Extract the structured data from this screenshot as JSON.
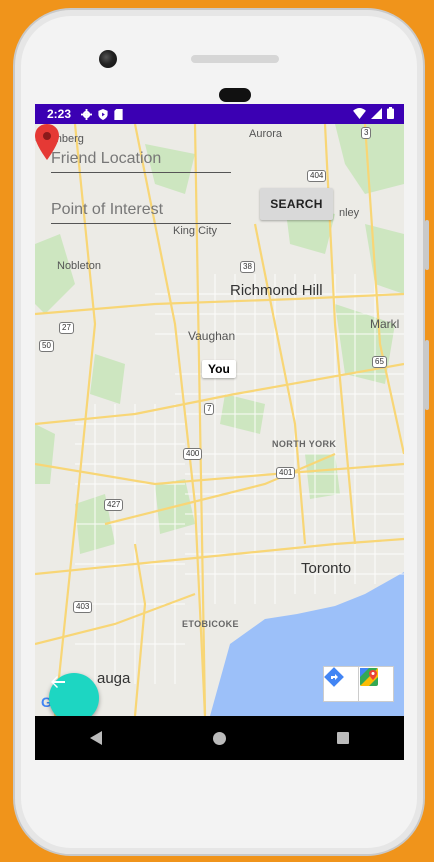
{
  "status": {
    "time": "2:23"
  },
  "form": {
    "friend_placeholder": "Friend Location",
    "poi_placeholder": "Point of Interest",
    "search_label": "SEARCH"
  },
  "map": {
    "places": {
      "aurora": "Aurora",
      "schomberg": "chomberg",
      "nobleton": "Nobleton",
      "king_city": "King City",
      "stouffville_partial": "nley",
      "richmond_hill": "Richmond Hill",
      "vaughan": "Vaughan",
      "markham_partial": "Markl",
      "north_york": "NORTH YORK",
      "toronto": "Toronto",
      "etobicoke": "ETOBICOKE",
      "mississauga_partial": "auga"
    },
    "highways": {
      "h3": "3",
      "h404": "404",
      "h404b": "404",
      "h38": "38",
      "h27": "27",
      "h50": "50",
      "h65": "65",
      "h400": "400",
      "h401": "401",
      "h427": "427",
      "h403": "403",
      "h7": "7"
    },
    "marker_label": "You",
    "attribution": "Google"
  },
  "icons": {
    "back_fab": "arrow-left-icon",
    "directions": "directions-icon",
    "maps": "google-maps-icon"
  },
  "colors": {
    "statusbar": "#3B00B3",
    "fab": "#1DD6C2",
    "marker": "#E53935",
    "background": "#F0941B"
  }
}
